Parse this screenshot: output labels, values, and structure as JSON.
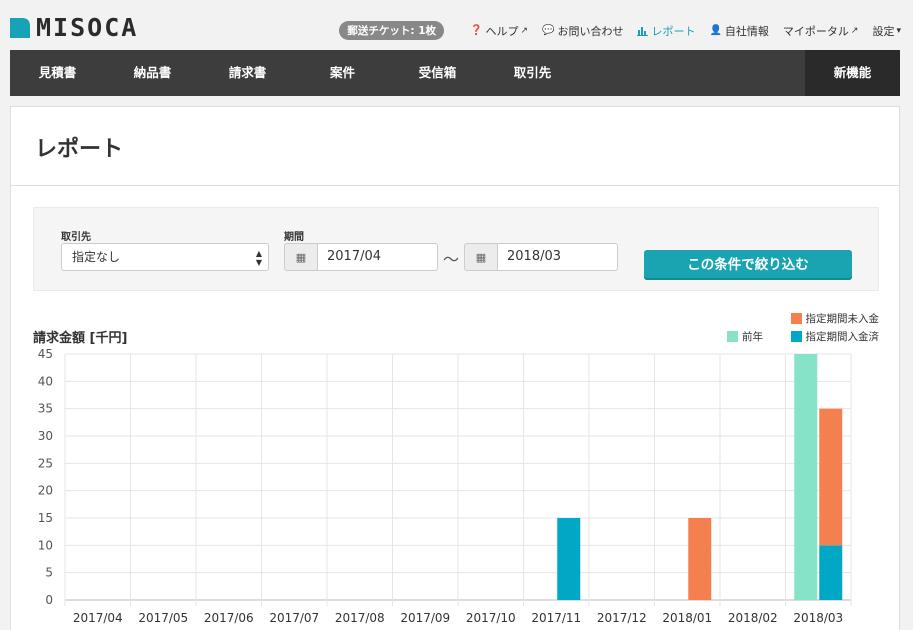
{
  "brand": {
    "name": "MISOCA",
    "accent": "#17a2b8"
  },
  "header": {
    "ticket_badge": "郵送チケット: 1枚",
    "links": [
      {
        "label": "ヘルプ",
        "icon": "question-circle-icon",
        "external": true
      },
      {
        "label": "お問い合わせ",
        "icon": "comment-icon",
        "external": false
      },
      {
        "label": "レポート",
        "icon": "bar-chart-icon",
        "external": false,
        "active": true
      },
      {
        "label": "自社情報",
        "icon": "user-icon",
        "external": false
      },
      {
        "label": "マイポータル",
        "icon": "",
        "external": true
      },
      {
        "label": "設定",
        "icon": "caret-down-icon",
        "external": false
      }
    ]
  },
  "nav": {
    "items": [
      "見積書",
      "納品書",
      "請求書",
      "案件",
      "受信箱",
      "取引先"
    ],
    "new_features": "新機能"
  },
  "page": {
    "title": "レポート"
  },
  "filter": {
    "client_label": "取引先",
    "client_value": "指定なし",
    "period_label": "期間",
    "date_from": "2017/04",
    "date_to": "2018/03",
    "tilde": "〜",
    "submit_label": "この条件で絞り込む"
  },
  "chart_data": {
    "type": "bar",
    "title": "請求金額 [千円]",
    "categories": [
      "2017/04",
      "2017/05",
      "2017/06",
      "2017/07",
      "2017/08",
      "2017/09",
      "2017/10",
      "2017/11",
      "2017/12",
      "2018/01",
      "2018/02",
      "2018/03"
    ],
    "ylim": [
      0,
      45
    ],
    "yticks": [
      0,
      5,
      10,
      15,
      20,
      25,
      30,
      35,
      40,
      45
    ],
    "grid": true,
    "legend_placement": "top-right",
    "series": [
      {
        "name": "前年",
        "color": "#86e3c8",
        "stack": "prev",
        "values": [
          0,
          0,
          0,
          0,
          0,
          0,
          0,
          0,
          0,
          0,
          0,
          45
        ]
      },
      {
        "name": "指定期間入金済",
        "color": "#00a8c6",
        "stack": "current",
        "values": [
          0,
          0,
          0,
          0,
          0,
          0,
          0,
          15,
          0,
          0,
          0,
          10
        ]
      },
      {
        "name": "指定期間未入金",
        "color": "#f5804f",
        "stack": "current",
        "values": [
          0,
          0,
          0,
          0,
          0,
          0,
          0,
          0,
          0,
          15,
          0,
          25
        ]
      }
    ]
  }
}
